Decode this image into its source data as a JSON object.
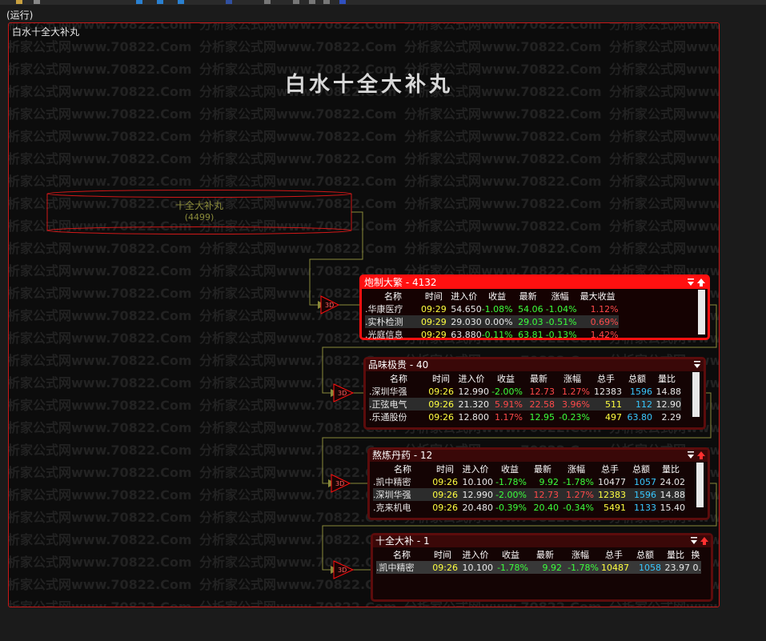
{
  "status_text": "(运行)",
  "canvas_label": "白水十全大补丸",
  "main_title": "白水十全大补丸",
  "watermark": "分析家公式网www.70822.Com",
  "strategy": {
    "label": "十全大补丸",
    "count": "(4499)"
  },
  "filter_icon_text": "3D",
  "panels": [
    {
      "title": "炮制大繁 - 4132",
      "headers": [
        "名称",
        "时间",
        "进入价",
        "收益",
        "最新",
        "涨幅",
        "最大收益"
      ],
      "rows": [
        [
          ".华康医疗",
          "09:29",
          "54.650",
          "-1.08%",
          "54.06",
          "-1.04%",
          "1.12%"
        ],
        [
          ".实朴检测",
          "09:29",
          "29.030",
          "0.00%",
          "29.03",
          "-0.51%",
          "0.69%"
        ],
        [
          ".光庭信息",
          "09:29",
          "63.880",
          "-0.11%",
          "63.81",
          "-0.13%",
          "1.42%"
        ]
      ]
    },
    {
      "title": "品味极贵 - 40",
      "headers": [
        "名称",
        "时间",
        "进入价",
        "收益",
        "最新",
        "涨幅",
        "总手",
        "总额",
        "量比"
      ],
      "rows": [
        [
          ".深圳华强",
          "09:26",
          "12.990",
          "-2.00%",
          "12.73",
          "1.27%",
          "12383",
          "1596",
          "14.88"
        ],
        [
          ".正弦电气",
          "09:26",
          "21.320",
          "5.91%",
          "22.58",
          "3.96%",
          "511",
          "112",
          "12.90"
        ],
        [
          ".乐通股份",
          "09:26",
          "12.800",
          "1.17%",
          "12.95",
          "-0.23%",
          "497",
          "63.80",
          "2.29"
        ]
      ]
    },
    {
      "title": "熬炼丹药 - 12",
      "headers": [
        "名称",
        "时间",
        "进入价",
        "收益",
        "最新",
        "涨幅",
        "总手",
        "总额",
        "量比"
      ],
      "rows": [
        [
          ".凯中精密",
          "09:26",
          "10.100",
          "-1.78%",
          "9.92",
          "-1.78%",
          "10477",
          "1057",
          "24.02"
        ],
        [
          ".深圳华强",
          "09:26",
          "12.990",
          "-2.00%",
          "12.73",
          "1.27%",
          "12383",
          "1596",
          "14.88"
        ],
        [
          ".克来机电",
          "09:26",
          "20.480",
          "-0.39%",
          "20.40",
          "-0.34%",
          "5491",
          "1133",
          "15.40"
        ]
      ]
    },
    {
      "title": "十全大补 - 1",
      "headers": [
        "名称",
        "时间",
        "进入价",
        "收益",
        "最新",
        "涨幅",
        "总手",
        "总额",
        "量比",
        "换"
      ],
      "rows": [
        [
          ".凯中精密",
          "09:26",
          "10.100",
          "-1.78%",
          "9.92",
          "-1.78%",
          "10487",
          "1058",
          "23.97",
          "0."
        ]
      ]
    }
  ],
  "colors": {
    "red": "#ff1010",
    "dark_red": "#5c0c0c",
    "line": "#8a8a3a",
    "up": "#ff4a4a",
    "down": "#3cff3c",
    "time": "#ffff40",
    "amount": "#38c8ff"
  }
}
